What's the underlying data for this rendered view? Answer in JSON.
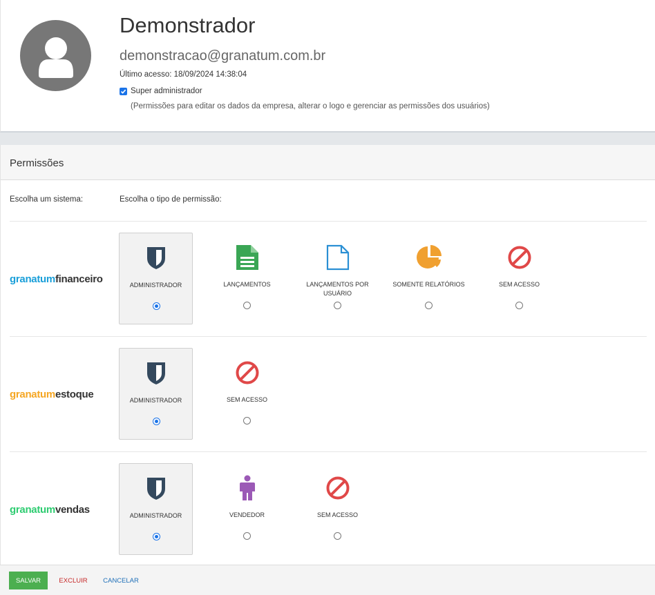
{
  "profile": {
    "name": "Demonstrador",
    "email": "demonstracao@granatum.com.br",
    "last_access": "Último acesso: 18/09/2024 14:38:04",
    "super_admin_label": "Super administrador",
    "super_admin_checked": true,
    "super_admin_note": "(Permissões para editar os dados da empresa, alterar o logo e gerenciar as permissões dos usuários)",
    "avatar_icon": "user-icon"
  },
  "permissions": {
    "title": "Permissões",
    "choose_system_label": "Escolha um sistema:",
    "choose_type_label": "Escolha o tipo de permissão:",
    "systems": [
      {
        "brand": "granatum",
        "suffix": "financeiro",
        "brand_color": "#1a9fd9",
        "options": [
          {
            "label": "ADMINISTRADOR",
            "icon": "shield-icon",
            "selected": true
          },
          {
            "label": "LANÇAMENTOS",
            "icon": "document-icon",
            "selected": false
          },
          {
            "label": "LANÇAMENTOS POR USUÁRIO",
            "icon": "blank-document-icon",
            "selected": false
          },
          {
            "label": "SOMENTE RELATÓRIOS",
            "icon": "pie-chart-icon",
            "selected": false
          },
          {
            "label": "SEM ACESSO",
            "icon": "forbidden-icon",
            "selected": false
          }
        ]
      },
      {
        "brand": "granatum",
        "suffix": "estoque",
        "brand_color": "#f5a623",
        "options": [
          {
            "label": "ADMINISTRADOR",
            "icon": "shield-icon",
            "selected": true
          },
          {
            "label": "SEM ACESSO",
            "icon": "forbidden-icon",
            "selected": false
          }
        ]
      },
      {
        "brand": "granatum",
        "suffix": "vendas",
        "brand_color": "#2ecc71",
        "options": [
          {
            "label": "ADMINISTRADOR",
            "icon": "shield-icon",
            "selected": true
          },
          {
            "label": "VENDEDOR",
            "icon": "person-icon",
            "selected": false
          },
          {
            "label": "SEM ACESSO",
            "icon": "forbidden-icon",
            "selected": false
          }
        ]
      }
    ]
  },
  "footer": {
    "save_label": "SALVAR",
    "delete_label": "EXCLUIR",
    "cancel_label": "CANCELAR"
  },
  "colors": {
    "save_green": "#4caf50",
    "delete_red": "#c62828",
    "cancel_blue": "#1e6fb8",
    "shield_navy": "#34495e",
    "document_green": "#3aa655",
    "blank_document_blue": "#2a8fd4",
    "pie_orange": "#f0a030",
    "forbidden_red": "#e04848",
    "person_purple": "#9b59b6"
  }
}
